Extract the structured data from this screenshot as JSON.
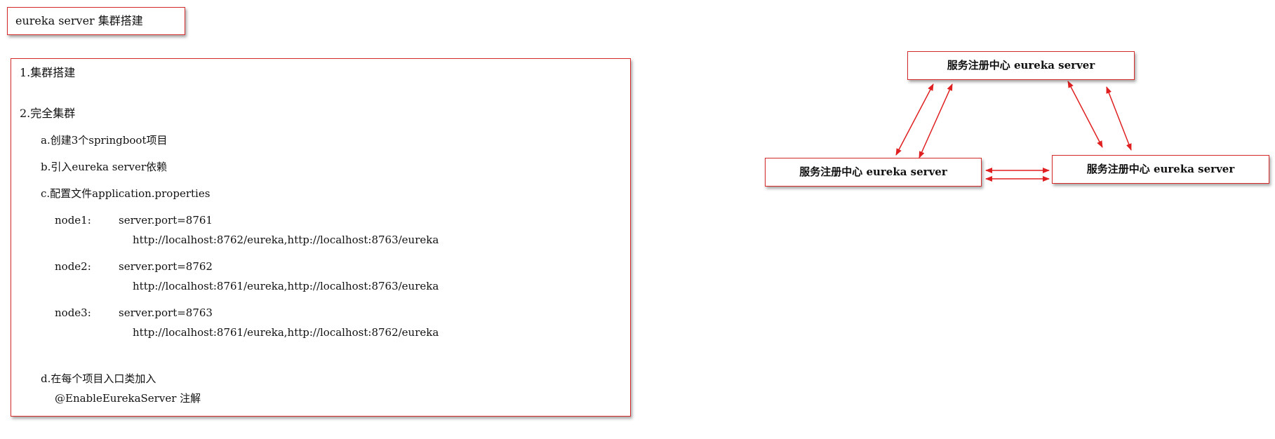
{
  "title": "eureka server 集群搭建",
  "content": {
    "step1": "1.集群搭建",
    "step2": "2.完全集群",
    "sub_a": "a.创建3个springboot项目",
    "sub_b": "b.引入eureka server依赖",
    "sub_c": "c.配置文件application.properties",
    "nodes": [
      {
        "label": "node1:",
        "port": "server.port=8761",
        "urls": "http://localhost:8762/eureka,http://localhost:8763/eureka"
      },
      {
        "label": "node2:",
        "port": "server.port=8762",
        "urls": "http://localhost:8761/eureka,http://localhost:8763/eureka"
      },
      {
        "label": "node3:",
        "port": "server.port=8763",
        "urls": "http://localhost:8761/eureka,http://localhost:8762/eureka"
      }
    ],
    "sub_d": "d.在每个项目入口类加入",
    "annotation": "@EnableEurekaServer 注解"
  },
  "diagram": {
    "top_node": "服务注册中心 eureka server",
    "left_node": "服务注册中心 eureka server",
    "right_node": "服务注册中心 eureka server",
    "arrow_color": "#e02020"
  }
}
